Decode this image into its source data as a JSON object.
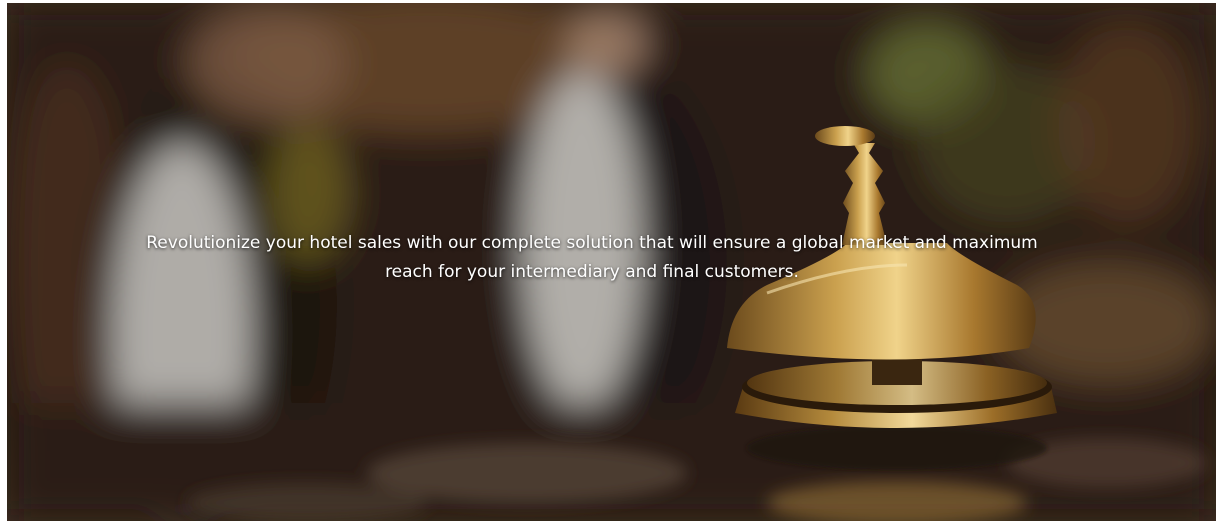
{
  "hero": {
    "text": "Revolutionize your hotel sales with our complete solution that will ensure a global market and maximum reach for your intermediary and final customers.",
    "image_subject": "hotel-reception-desk-bell"
  },
  "colors": {
    "overlay_text": "#ffffff",
    "bell_brass": "#b8893a",
    "background_dark": "#2a1d14"
  }
}
